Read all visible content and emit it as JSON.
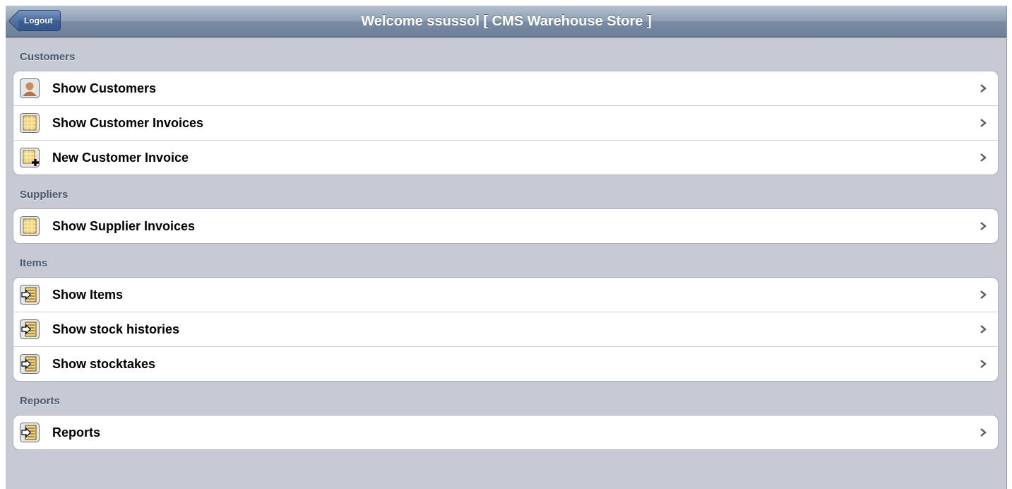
{
  "navbar": {
    "title": "Welcome ssussol [ CMS Warehouse Store ]",
    "back_label": "Logout"
  },
  "sections": [
    {
      "header": "Customers",
      "items": [
        {
          "label": "Show Customers",
          "icon": "person-icon"
        },
        {
          "label": "Show Customer Invoices",
          "icon": "invoice-grid-icon"
        },
        {
          "label": "New Customer Invoice",
          "icon": "invoice-add-icon"
        }
      ]
    },
    {
      "header": "Suppliers",
      "items": [
        {
          "label": "Show Supplier Invoices",
          "icon": "invoice-grid-icon"
        }
      ]
    },
    {
      "header": "Items",
      "items": [
        {
          "label": "Show Items",
          "icon": "document-arrow-icon"
        },
        {
          "label": "Show stock histories",
          "icon": "document-arrow-icon"
        },
        {
          "label": "Show stocktakes",
          "icon": "document-arrow-icon"
        }
      ]
    },
    {
      "header": "Reports",
      "items": [
        {
          "label": "Reports",
          "icon": "document-arrow-icon"
        }
      ]
    }
  ],
  "colors": {
    "background": "#c5cad4",
    "navbar": "#8c9db3",
    "back_button": "#3b5f93",
    "section_header": "#4c566c"
  }
}
